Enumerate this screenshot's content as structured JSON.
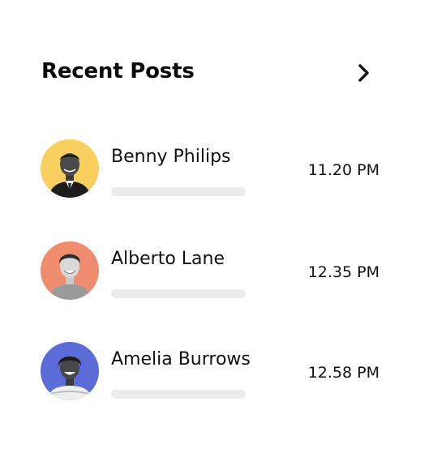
{
  "header": {
    "title": "Recent Posts",
    "next_icon": "chevron-right-icon"
  },
  "posts": [
    {
      "name": "Benny Philips",
      "time": "11.20 PM",
      "avatar_bg": "#f9cf5f"
    },
    {
      "name": "Alberto Lane",
      "time": "12.35 PM",
      "avatar_bg": "#f08c6e"
    },
    {
      "name": "Amelia Burrows",
      "time": "12.58 PM",
      "avatar_bg": "#5b6bd8"
    }
  ],
  "colors": {
    "text": "#111111",
    "placeholder_bar": "#ececec",
    "background": "#ffffff"
  }
}
